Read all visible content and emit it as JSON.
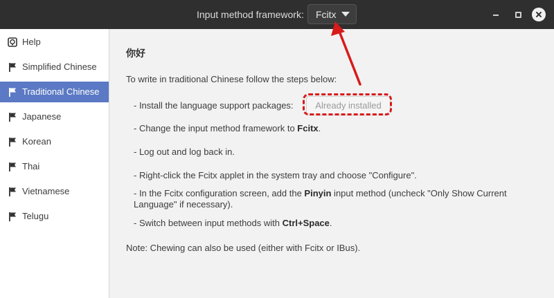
{
  "titlebar": {
    "framework_label": "Input method framework:",
    "framework_value": "Fcitx"
  },
  "sidebar": {
    "items": [
      {
        "label": "Help",
        "icon": "help-icon"
      },
      {
        "label": "Simplified Chinese",
        "icon": "flag-icon"
      },
      {
        "label": "Traditional Chinese",
        "icon": "flag-icon",
        "selected": true
      },
      {
        "label": "Japanese",
        "icon": "flag-icon"
      },
      {
        "label": "Korean",
        "icon": "flag-icon"
      },
      {
        "label": "Thai",
        "icon": "flag-icon"
      },
      {
        "label": "Vietnamese",
        "icon": "flag-icon"
      },
      {
        "label": "Telugu",
        "icon": "flag-icon"
      }
    ]
  },
  "main": {
    "title": "你好",
    "intro": "To write in traditional Chinese follow the steps below:",
    "steps": {
      "install_prefix": "- Install the language support packages:",
      "install_button": "Already installed",
      "change_prefix": "- Change the input method framework to ",
      "change_value": "Fcitx",
      "change_suffix": ".",
      "logout": "- Log out and log back in.",
      "rightclick": "- Right-click the Fcitx applet in the system tray and choose \"Configure\".",
      "config_prefix": "- In the Fcitx configuration screen, add the ",
      "config_method": "Pinyin",
      "config_suffix1": " input method (uncheck \"Only Show Current",
      "config_suffix2": "Language\" if necessary).",
      "switch_prefix": "- Switch between input methods with ",
      "switch_keys": "Ctrl+Space",
      "switch_suffix": "."
    },
    "note": "Note: Chewing can also be used (either with Fcitx or IBus)."
  },
  "colors": {
    "titlebar_bg": "#2f2f2f",
    "selected_bg": "#5b79c4",
    "annotation_red": "#d81a1a"
  }
}
